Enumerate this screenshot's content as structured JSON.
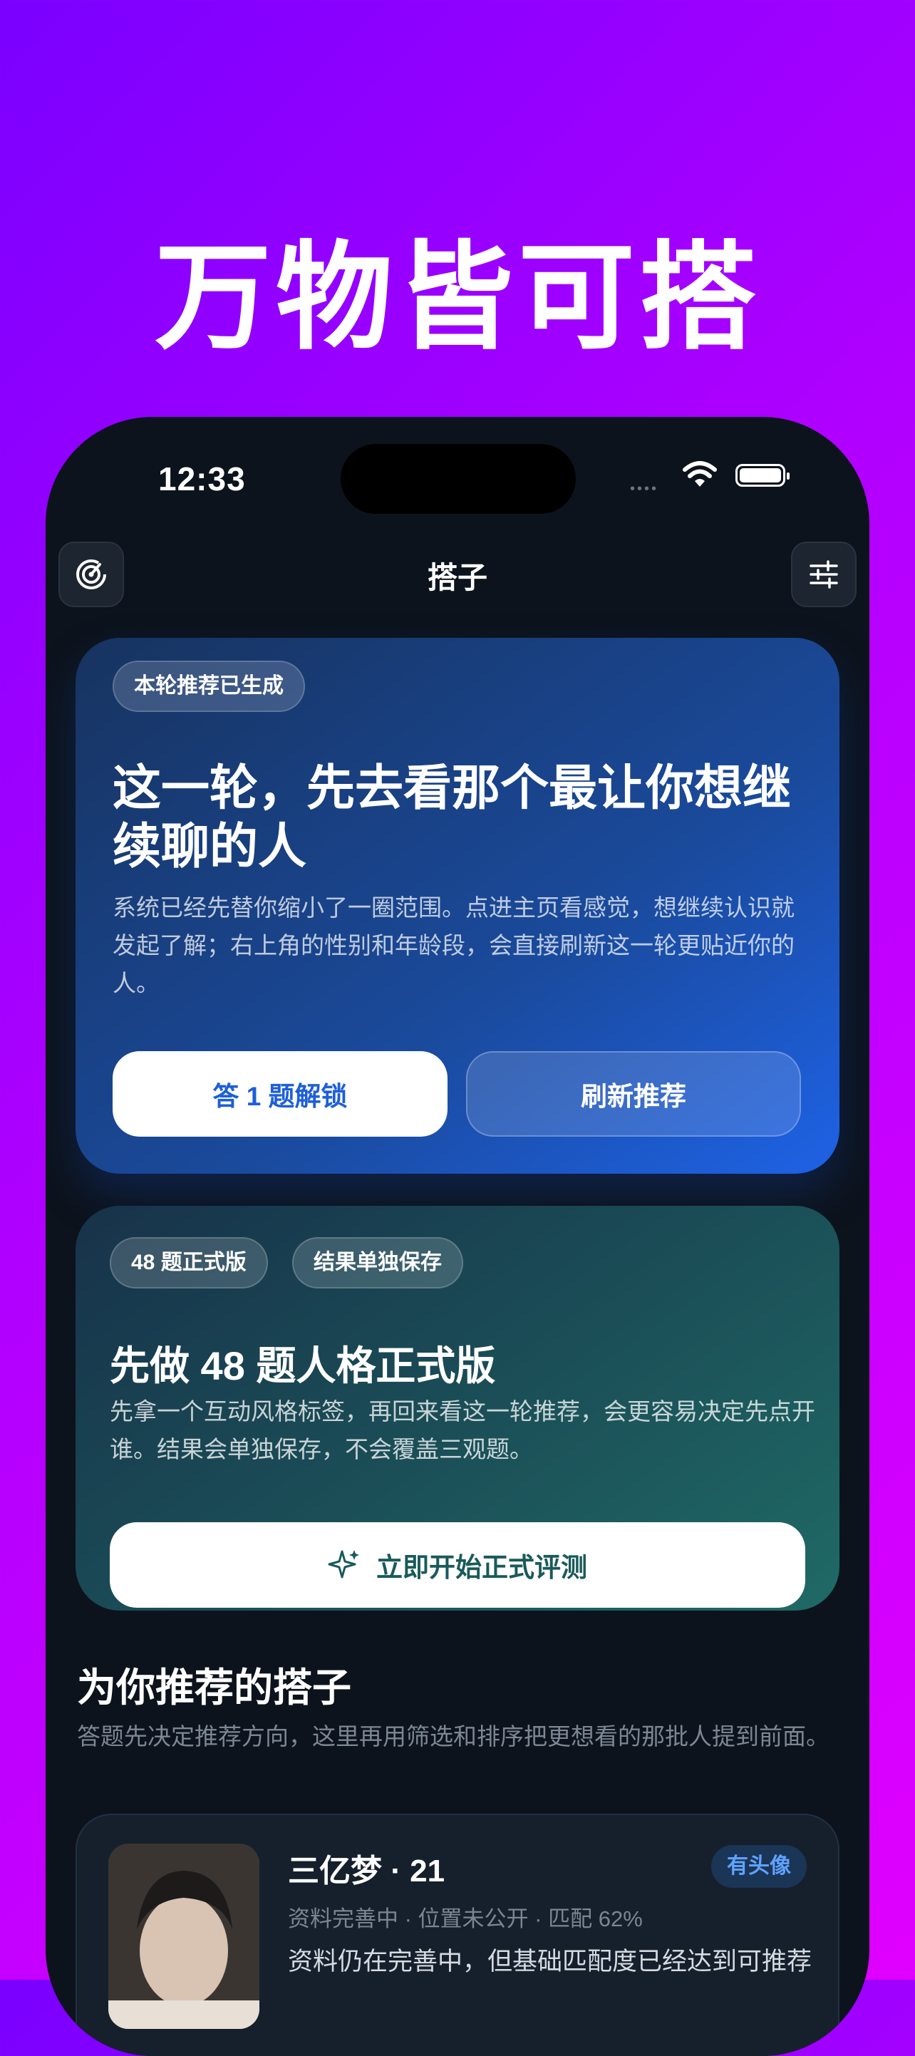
{
  "headline": "万物皆可搭",
  "status_bar": {
    "time": "12:33",
    "signal": "••••"
  },
  "nav": {
    "title": "搭子",
    "left_icon": "radar-icon",
    "right_icon": "sliders-icon"
  },
  "card1": {
    "chip": "本轮推荐已生成",
    "title": "这一轮，先去看那个最让你想继续聊的人",
    "description": "系统已经先替你缩小了一圈范围。点进主页看感觉，想继续认识就发起了解；右上角的性别和年龄段，会直接刷新这一轮更贴近你的人。",
    "primary_button": "答 1 题解锁",
    "secondary_button": "刷新推荐"
  },
  "card2": {
    "chips": [
      "48 题正式版",
      "结果单独保存"
    ],
    "title": "先做 48 题人格正式版",
    "description": "先拿一个互动风格标签，再回来看这一轮推荐，会更容易决定先点开谁。结果会单独保存，不会覆盖三观题。",
    "button": "立即开始正式评测",
    "button_icon": "sparkle-icon"
  },
  "section": {
    "title": "为你推荐的搭子",
    "description": "答题先决定推荐方向，这里再用筛选和排序把更想看的那批人提到前面。"
  },
  "profile": {
    "name": "三亿梦 · 21",
    "badge": "有头像",
    "meta": "资料完善中 · 位置未公开 · 匹配 62%",
    "description": "资料仍在完善中，但基础匹配度已经达到可推荐"
  }
}
